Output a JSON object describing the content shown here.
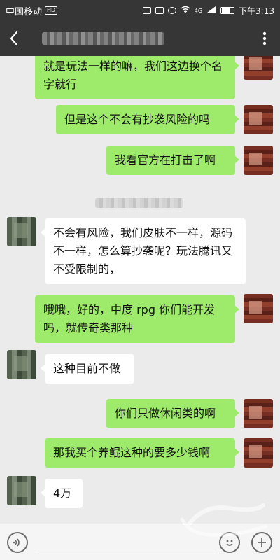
{
  "status_bar": {
    "carrier": "中国移动",
    "hd_badge": "HD",
    "network": "4G",
    "time": "下午3:13"
  },
  "messages": [
    {
      "from": "me",
      "text": "就是玩法一样的嘛，我们这边换个名字就行"
    },
    {
      "from": "me",
      "text": "但是这个不会有抄袭风险的吗"
    },
    {
      "from": "me",
      "text": "我看官方在打击了啊"
    },
    {
      "from": "them",
      "text": "不会有风险，我们皮肤不一样，源码不一样，怎么算抄袭呢？玩法腾讯又不受限制的，"
    },
    {
      "from": "me",
      "text": "哦哦，好的，中度 rpg 你们能开发吗，就传奇类那种"
    },
    {
      "from": "them",
      "text": "这种目前不做"
    },
    {
      "from": "me",
      "text": "你们只做休闲类的啊"
    },
    {
      "from": "me",
      "text": "那我买个养鲲这种的要多少钱啊"
    },
    {
      "from": "them",
      "text": "4万"
    }
  ],
  "input": {
    "placeholder": ""
  },
  "icons": {
    "back": "chevron-left-icon",
    "menu": "more-vertical-icon",
    "voice": "voice-icon",
    "emoji": "emoji-icon",
    "plus": "plus-icon"
  },
  "colors": {
    "bar": "#363636",
    "my_bubble": "#9eea6a",
    "their_bubble": "#ffffff",
    "chat_bg": "#ebebeb"
  }
}
